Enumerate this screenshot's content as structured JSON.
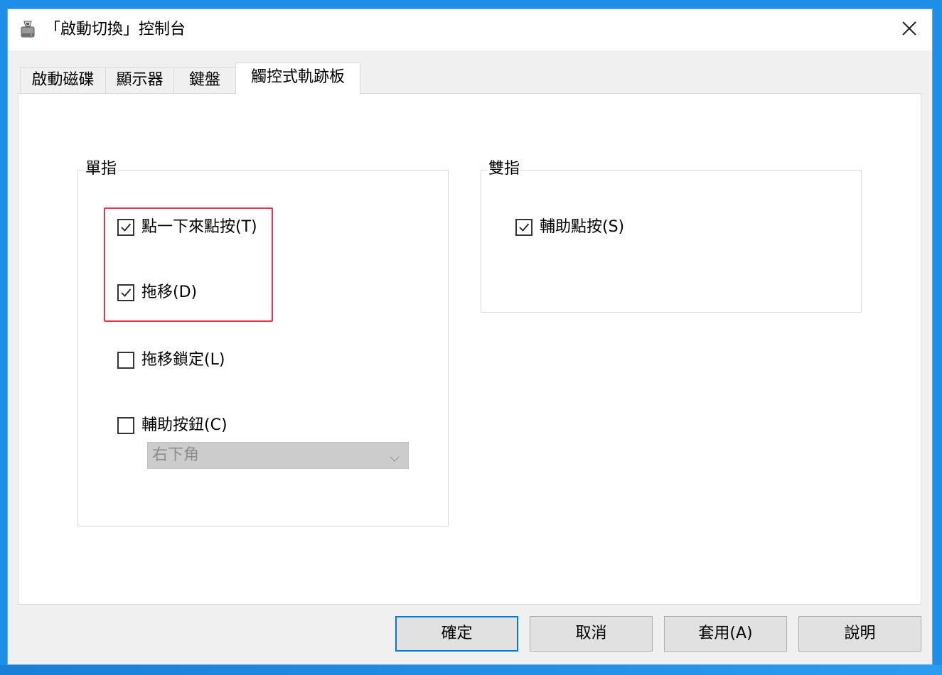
{
  "window": {
    "title": "「啟動切換」控制台",
    "icon": "disk-drive-icon",
    "close_icon": "close-icon"
  },
  "tabs": [
    {
      "label": "啟動磁碟",
      "active": false
    },
    {
      "label": "顯示器",
      "active": false
    },
    {
      "label": "鍵盤",
      "active": false
    },
    {
      "label": "觸控式軌跡板",
      "active": true
    }
  ],
  "single_finger": {
    "legend": "單指",
    "tap_to_click": {
      "label": "點一下來點按(T)",
      "checked": true
    },
    "drag": {
      "label": "拖移(D)",
      "checked": true
    },
    "drag_lock": {
      "label": "拖移鎖定(L)",
      "checked": false
    },
    "secondary_button": {
      "label": "輔助按鈕(C)",
      "checked": false
    },
    "secondary_corner": {
      "value": "右下角",
      "enabled": false
    }
  },
  "two_finger": {
    "legend": "雙指",
    "secondary_click": {
      "label": "輔助點按(S)",
      "checked": true
    }
  },
  "buttons": {
    "ok": "確定",
    "cancel": "取消",
    "apply": "套用(A)",
    "help": "說明"
  },
  "colors": {
    "highlight": "#e8334a",
    "desktop": "#1e8fe8",
    "default_button_border": "#0078d7"
  }
}
